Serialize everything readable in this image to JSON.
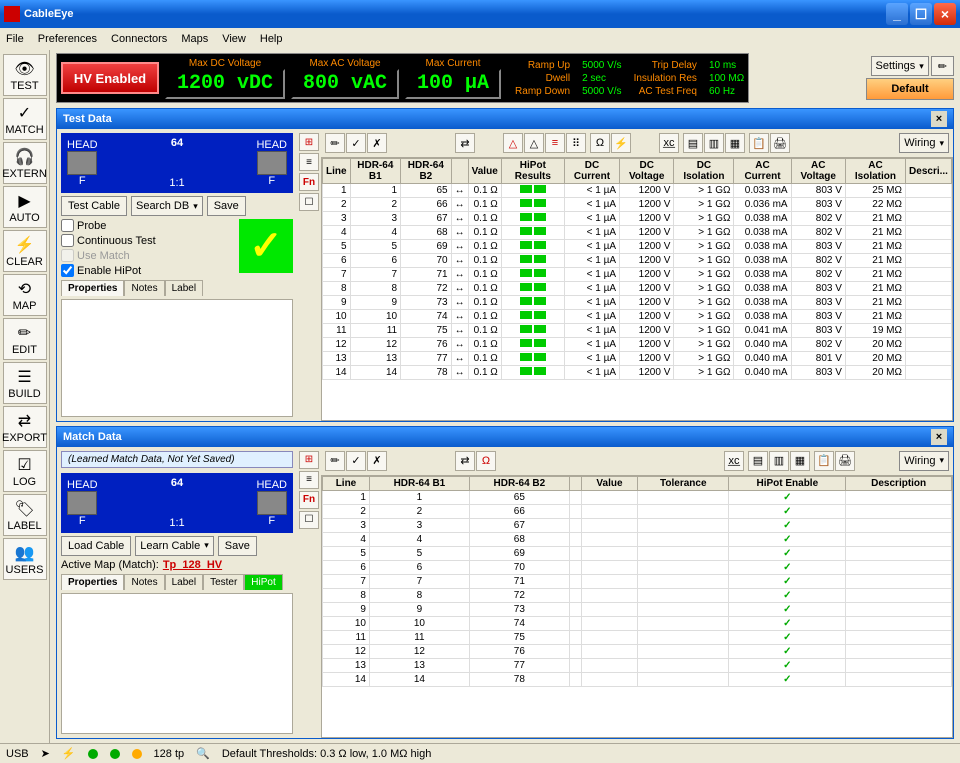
{
  "title": "CableEye",
  "menus": [
    "File",
    "Preferences",
    "Connectors",
    "Maps",
    "View",
    "Help"
  ],
  "hv": {
    "badge": "HV Enabled",
    "dcLabel": "Max DC Voltage",
    "dcVal": "1200 vDC",
    "acLabel": "Max AC Voltage",
    "acVal": "800 vAC",
    "curLabel": "Max Current",
    "curVal": "100 µA",
    "info": [
      {
        "k": "Ramp Up",
        "v": "5000 V/s"
      },
      {
        "k": "Trip Delay",
        "v": "10 ms"
      },
      {
        "k": "Dwell",
        "v": "2 sec"
      },
      {
        "k": "Insulation Res",
        "v": "100 MΩ"
      },
      {
        "k": "Ramp Down",
        "v": "5000 V/s"
      },
      {
        "k": "AC Test Freq",
        "v": "60 Hz"
      }
    ],
    "settings": "Settings",
    "default": "Default"
  },
  "sidebar": [
    {
      "ic": "👁",
      "t": "TEST"
    },
    {
      "ic": "✓",
      "t": "MATCH"
    },
    {
      "ic": "🎧",
      "t": "EXTERN"
    },
    {
      "ic": "▶",
      "t": "AUTO"
    },
    {
      "ic": "⚡",
      "t": "CLEAR"
    },
    {
      "ic": "⟲",
      "t": "MAP"
    },
    {
      "ic": "✏",
      "t": "EDIT"
    },
    {
      "ic": "☰",
      "t": "BUILD"
    },
    {
      "ic": "⇄",
      "t": "EXPORT"
    },
    {
      "ic": "☑",
      "t": "LOG"
    },
    {
      "ic": "🏷",
      "t": "LABEL"
    },
    {
      "ic": "👥",
      "t": "USERS"
    }
  ],
  "testdata": {
    "title": "Test Data",
    "pic": {
      "num": "64",
      "l": "HEAD",
      "r": "HEAD",
      "ratio": "1:1",
      "lf": "F",
      "rf": "F"
    },
    "btns": {
      "test": "Test Cable",
      "search": "Search DB",
      "save": "Save"
    },
    "checks": {
      "probe": "Probe",
      "cont": "Continuous Test",
      "match": "Use Match",
      "hipot": "Enable HiPot"
    },
    "tabs": [
      "Properties",
      "Notes",
      "Label"
    ],
    "cols": [
      "Line",
      "HDR-64 B1",
      "HDR-64 B2",
      "",
      "Value",
      "HiPot Results",
      "DC Current",
      "DC Voltage",
      "DC Isolation",
      "AC Current",
      "AC Voltage",
      "AC Isolation",
      "Descri..."
    ],
    "wiring": "Wiring",
    "rows": [
      [
        1,
        1,
        65,
        "↔",
        "0.1 Ω",
        "< 1 µA",
        "1200 V",
        "> 1 GΩ",
        "0.033 mA",
        "803 V",
        "25 MΩ"
      ],
      [
        2,
        2,
        66,
        "↔",
        "0.1 Ω",
        "< 1 µA",
        "1200 V",
        "> 1 GΩ",
        "0.036 mA",
        "803 V",
        "22 MΩ"
      ],
      [
        3,
        3,
        67,
        "↔",
        "0.1 Ω",
        "< 1 µA",
        "1200 V",
        "> 1 GΩ",
        "0.038 mA",
        "802 V",
        "21 MΩ"
      ],
      [
        4,
        4,
        68,
        "↔",
        "0.1 Ω",
        "< 1 µA",
        "1200 V",
        "> 1 GΩ",
        "0.038 mA",
        "802 V",
        "21 MΩ"
      ],
      [
        5,
        5,
        69,
        "↔",
        "0.1 Ω",
        "< 1 µA",
        "1200 V",
        "> 1 GΩ",
        "0.038 mA",
        "803 V",
        "21 MΩ"
      ],
      [
        6,
        6,
        70,
        "↔",
        "0.1 Ω",
        "< 1 µA",
        "1200 V",
        "> 1 GΩ",
        "0.038 mA",
        "802 V",
        "21 MΩ"
      ],
      [
        7,
        7,
        71,
        "↔",
        "0.1 Ω",
        "< 1 µA",
        "1200 V",
        "> 1 GΩ",
        "0.038 mA",
        "802 V",
        "21 MΩ"
      ],
      [
        8,
        8,
        72,
        "↔",
        "0.1 Ω",
        "< 1 µA",
        "1200 V",
        "> 1 GΩ",
        "0.038 mA",
        "803 V",
        "21 MΩ"
      ],
      [
        9,
        9,
        73,
        "↔",
        "0.1 Ω",
        "< 1 µA",
        "1200 V",
        "> 1 GΩ",
        "0.038 mA",
        "803 V",
        "21 MΩ"
      ],
      [
        10,
        10,
        74,
        "↔",
        "0.1 Ω",
        "< 1 µA",
        "1200 V",
        "> 1 GΩ",
        "0.038 mA",
        "803 V",
        "21 MΩ"
      ],
      [
        11,
        11,
        75,
        "↔",
        "0.1 Ω",
        "< 1 µA",
        "1200 V",
        "> 1 GΩ",
        "0.041 mA",
        "803 V",
        "19 MΩ"
      ],
      [
        12,
        12,
        76,
        "↔",
        "0.1 Ω",
        "< 1 µA",
        "1200 V",
        "> 1 GΩ",
        "0.040 mA",
        "802 V",
        "20 MΩ"
      ],
      [
        13,
        13,
        77,
        "↔",
        "0.1 Ω",
        "< 1 µA",
        "1200 V",
        "> 1 GΩ",
        "0.040 mA",
        "801 V",
        "20 MΩ"
      ],
      [
        14,
        14,
        78,
        "↔",
        "0.1 Ω",
        "< 1 µA",
        "1200 V",
        "> 1 GΩ",
        "0.040 mA",
        "803 V",
        "20 MΩ"
      ]
    ]
  },
  "matchdata": {
    "title": "Match Data",
    "info": "(Learned Match Data, Not Yet Saved)",
    "pic": {
      "num": "64",
      "l": "HEAD",
      "r": "HEAD",
      "ratio": "1:1",
      "lf": "F",
      "rf": "F"
    },
    "btns": {
      "load": "Load Cable",
      "learn": "Learn Cable",
      "save": "Save"
    },
    "activemap": {
      "label": "Active Map (Match):",
      "val": "Tp_128_HV"
    },
    "tabs": [
      "Properties",
      "Notes",
      "Label",
      "Tester",
      "HiPot"
    ],
    "cols": [
      "Line",
      "HDR-64 B1",
      "HDR-64 B2",
      "",
      "Value",
      "Tolerance",
      "HiPot Enable",
      "Description"
    ],
    "wiring": "Wiring",
    "rows": [
      [
        1,
        1,
        65
      ],
      [
        2,
        2,
        66
      ],
      [
        3,
        3,
        67
      ],
      [
        4,
        4,
        68
      ],
      [
        5,
        5,
        69
      ],
      [
        6,
        6,
        70
      ],
      [
        7,
        7,
        71
      ],
      [
        8,
        8,
        72
      ],
      [
        9,
        9,
        73
      ],
      [
        10,
        10,
        74
      ],
      [
        11,
        11,
        75
      ],
      [
        12,
        12,
        76
      ],
      [
        13,
        13,
        77
      ],
      [
        14,
        14,
        78
      ]
    ]
  },
  "status": {
    "usb": "USB",
    "tp": "128 tp",
    "thresh": "Default Thresholds: 0.3 Ω low, 1.0 MΩ high"
  }
}
